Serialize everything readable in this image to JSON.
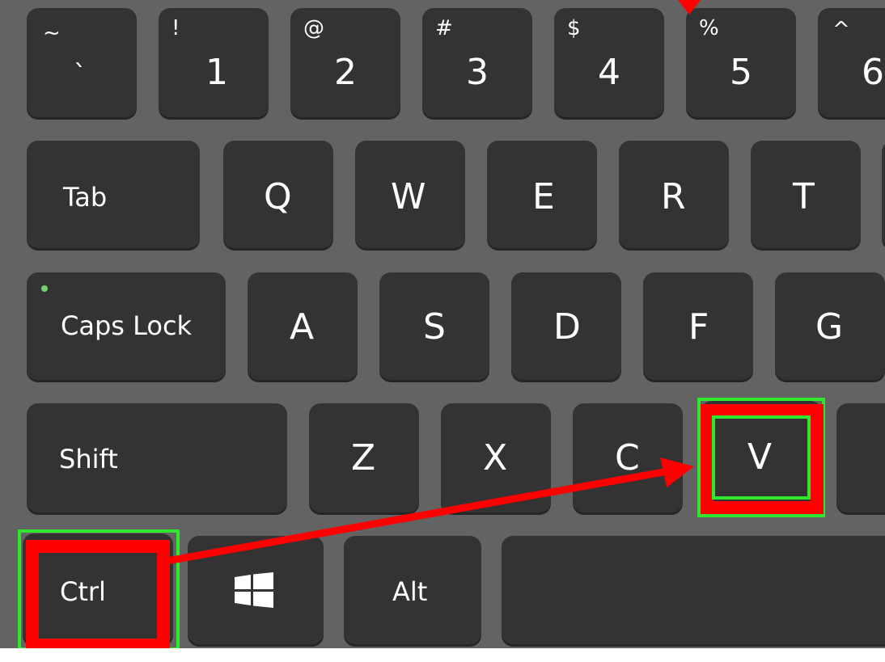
{
  "keyboard": {
    "number_row": [
      {
        "shift": "~",
        "main": "`"
      },
      {
        "shift": "!",
        "main": "1"
      },
      {
        "shift": "@",
        "main": "2"
      },
      {
        "shift": "#",
        "main": "3"
      },
      {
        "shift": "$",
        "main": "4"
      },
      {
        "shift": "%",
        "main": "5"
      },
      {
        "shift": "^",
        "main": "6"
      }
    ],
    "top_row": [
      "Tab",
      "Q",
      "W",
      "E",
      "R",
      "T"
    ],
    "home_row": [
      "Caps Lock",
      "A",
      "S",
      "D",
      "F",
      "G"
    ],
    "bottom_row": [
      "Shift",
      "Z",
      "X",
      "C",
      "V"
    ],
    "modifier_row": [
      "Ctrl",
      "Alt"
    ]
  },
  "highlight": {
    "from_key": "Ctrl",
    "to_key": "V",
    "border_color": "#ff0000",
    "inner_color": "#2ee82e",
    "arrow_color": "#ff0000"
  },
  "colors": {
    "keycap": "#333333",
    "frame": "#636363",
    "legend": "#ffffff",
    "caps_led": "#6fd36f"
  }
}
